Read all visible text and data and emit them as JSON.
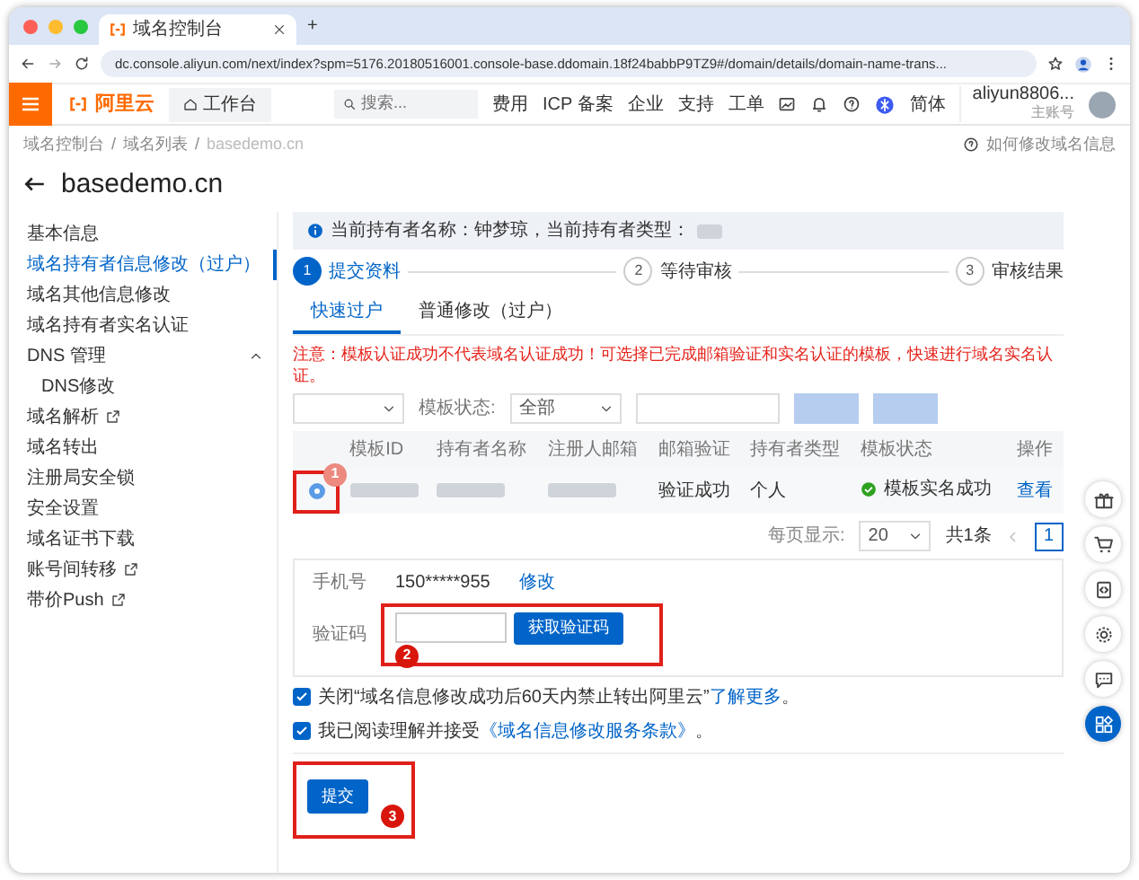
{
  "browser": {
    "tab_title": "域名控制台",
    "new_tab": "+",
    "url": "dc.console.aliyun.com/next/index?spm=5176.20180516001.console-base.ddomain.18f24babbP9TZ9#/domain/details/domain-name-trans..."
  },
  "topbar": {
    "logo": "阿里云",
    "workbench": "工作台",
    "search_placeholder": "搜索...",
    "links": [
      "费用",
      "ICP 备案",
      "企业",
      "支持",
      "工单"
    ],
    "lang": "简体",
    "account": "aliyun8806...",
    "account_role": "主账号"
  },
  "breadcrumb": {
    "separator": "/",
    "items": [
      "域名控制台",
      "域名列表",
      "basedemo.cn"
    ]
  },
  "help_link": "如何修改域名信息",
  "page_title": "basedemo.cn",
  "sidebar": {
    "items": [
      {
        "label": "基本信息",
        "selected": false,
        "external": false
      },
      {
        "label": "域名持有者信息修改（过户）",
        "selected": true,
        "external": false
      },
      {
        "label": "域名其他信息修改",
        "selected": false,
        "external": false
      },
      {
        "label": "域名持有者实名认证",
        "selected": false,
        "external": false
      },
      {
        "label": "DNS 管理",
        "selected": false,
        "external": false,
        "expanded": true,
        "children": [
          {
            "label": "DNS修改",
            "selected": false,
            "external": false
          }
        ]
      },
      {
        "label": "域名解析",
        "selected": false,
        "external": true
      },
      {
        "label": "域名转出",
        "selected": false,
        "external": false
      },
      {
        "label": "注册局安全锁",
        "selected": false,
        "external": false
      },
      {
        "label": "安全设置",
        "selected": false,
        "external": false
      },
      {
        "label": "域名证书下载",
        "selected": false,
        "external": false
      },
      {
        "label": "账号间转移",
        "selected": false,
        "external": true
      },
      {
        "label": "带价Push",
        "selected": false,
        "external": true
      }
    ]
  },
  "info": "当前持有者名称：钟梦琼，当前持有者类型：",
  "steps": [
    {
      "number": "1",
      "label": "提交资料",
      "active": true
    },
    {
      "number": "2",
      "label": "等待审核",
      "active": false
    },
    {
      "number": "3",
      "label": "审核结果",
      "active": false
    }
  ],
  "tabs": [
    {
      "label": "快速过户",
      "selected": true
    },
    {
      "label": "普通修改（过户）",
      "selected": false
    }
  ],
  "warning": "注意：模板认证成功不代表域名认证成功！可选择已完成邮箱验证和实名认证的模板，快速进行域名实名认证。",
  "filters": [
    {
      "kind": "select"
    },
    {
      "kind": "select",
      "label": "模板状态:",
      "value": "全部"
    },
    {
      "kind": "input"
    },
    {
      "kind": "button"
    },
    {
      "kind": "button"
    }
  ],
  "table": {
    "columns": [
      "模板ID",
      "持有者名称",
      "注册人邮箱",
      "邮箱验证",
      "持有者类型",
      "模板状态",
      "操作"
    ],
    "rows": [
      {
        "selected": true,
        "cells": [
          {
            "kind": "redacted"
          },
          {
            "kind": "redacted"
          },
          {
            "kind": "redacted"
          },
          {
            "kind": "text",
            "text": "验证成功"
          },
          {
            "kind": "text",
            "text": "个人"
          },
          {
            "kind": "status",
            "text": "模板实名成功"
          },
          {
            "kind": "link",
            "text": "查看"
          }
        ]
      }
    ]
  },
  "pagination": {
    "per_page_label": "每页显示:",
    "per_page": "20",
    "total": "共1条",
    "pages": [
      {
        "label": "1",
        "selected": true
      }
    ]
  },
  "phone": {
    "label": "手机号",
    "value": "150*****955",
    "action": "修改"
  },
  "code": {
    "label": "验证码",
    "button": "获取验证码"
  },
  "agreements": [
    {
      "checked": true,
      "text": "关闭“域名信息修改成功后60天内禁止转出阿里云”",
      "link": "了解更多",
      "suffix": "。"
    },
    {
      "checked": true,
      "text": "我已阅读理解并接受",
      "link": "《域名信息修改服务条款》",
      "suffix": "。"
    }
  ],
  "submit": "提交",
  "annotations": [
    "1",
    "2",
    "3"
  ]
}
